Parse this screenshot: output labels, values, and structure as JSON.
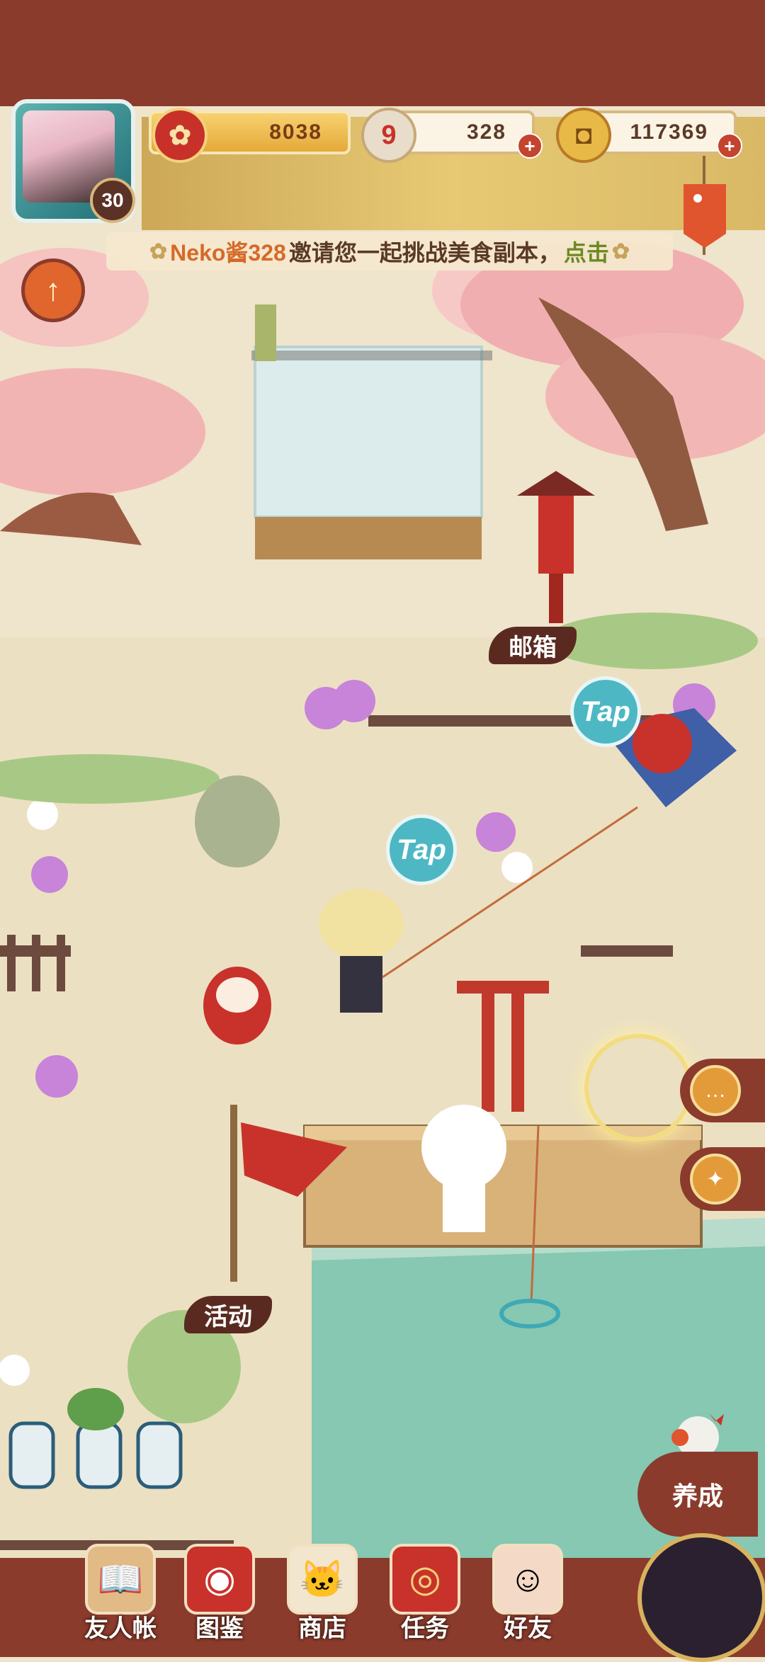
{
  "player": {
    "level": "30"
  },
  "resources": {
    "flower": {
      "value": "8038",
      "icon": "plum-blossom-icon"
    },
    "nine": {
      "value": "328",
      "icon": "nine-tails-icon"
    },
    "coin": {
      "value": "117369",
      "icon": "coin-icon"
    }
  },
  "invite": {
    "name": "Neko酱328",
    "message": "邀请您一起挑战美食副本，",
    "action": "点击"
  },
  "map_labels": {
    "mailbox": "邮箱",
    "event": "活动"
  },
  "tap_bubbles": [
    "Tap",
    "Tap"
  ],
  "side_buttons": [
    "chat-icon",
    "gift-icon"
  ],
  "cultivate_label": "养成",
  "bottom_nav": [
    {
      "label": "友人帐",
      "icon": "book-icon"
    },
    {
      "label": "图鉴",
      "icon": "eye-scroll-icon"
    },
    {
      "label": "商店",
      "icon": "lucky-cat-icon"
    },
    {
      "label": "任务",
      "icon": "task-icon"
    },
    {
      "label": "好友",
      "icon": "friends-icon"
    }
  ],
  "colors": {
    "frame": "#8a3b2c",
    "gold": "#e5a93a",
    "water": "#86c8b2",
    "tap": "#4db8c4"
  }
}
